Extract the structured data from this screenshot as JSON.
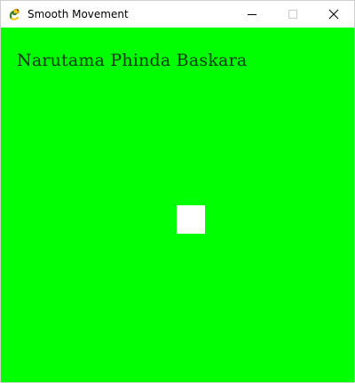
{
  "window": {
    "title": "Smooth Movement",
    "app_icon": "pygame-snake-icon"
  },
  "controls": {
    "minimize_icon": "minimize-icon",
    "maximize_icon": "maximize-icon",
    "close_icon": "close-icon"
  },
  "canvas": {
    "background_color": "#00ff00",
    "caption": "Narutama Phinda Baskara",
    "caption_color": "#0a3a0a",
    "square_color": "#ffffff"
  }
}
